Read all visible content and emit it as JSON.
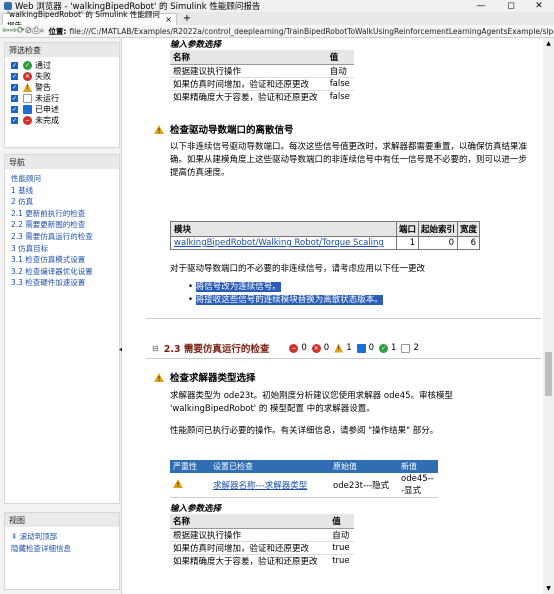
{
  "window": {
    "title": "Web 浏览器 - 'walkingBipedRobot' 的 Simulink 性能顾问报告",
    "min": "—",
    "max": "◻",
    "close": "✕"
  },
  "tab": {
    "label": "'walkingBipedRobot' 的 Simulink 性能顾问报告",
    "close": "×",
    "new": "+"
  },
  "address": {
    "label": "位置:",
    "url": "file:///C:/MATLAB/Examples/R2022a/control_deeplearning/TrainBipedRobotToWalkUsingReinforcementLearningAgentsExample/slprj/mo"
  },
  "filter": {
    "title": "筛选检查",
    "items": [
      {
        "label": "通过",
        "color": "#2e9e3e",
        "glyph": "✓"
      },
      {
        "label": "失败",
        "color": "#d0302a",
        "glyph": "✕"
      },
      {
        "label": "警告",
        "color": "#e3a21a",
        "glyph": "!"
      },
      {
        "label": "未运行",
        "color": "#ffffff",
        "glyph": ""
      },
      {
        "label": "已申述",
        "color": "#1c6fd1",
        "glyph": "■"
      },
      {
        "label": "未完成",
        "color": "#d0302a",
        "glyph": "−"
      }
    ]
  },
  "nav": {
    "title": "导航",
    "links": [
      "性能顾问",
      "1 基线",
      "2 仿真",
      "2.1 更新前执行的检查",
      "2.2 需要更新图的检查",
      "2.3 需要仿真运行的检查",
      "3 仿真目标",
      "3.1 检查仿真模式设置",
      "3.2 检查编译器优化设置",
      "3.3 检查硬件加速设置"
    ]
  },
  "view": {
    "title": "视图",
    "links": [
      "滚动到顶部",
      "隐藏检查详细信息"
    ]
  },
  "top_params": {
    "title": "输入参数选择",
    "header": [
      "名称",
      "值"
    ],
    "rows": [
      [
        "根据建议执行操作",
        "自动"
      ],
      [
        "如果仿真时间增加，验证和还原更改",
        "false"
      ],
      [
        "如果精确度大于容差，验证和还原更改",
        "false"
      ]
    ]
  },
  "sec1": {
    "title": "检查驱动导数端口的离散信号",
    "para": "以下非连续信号驱动导数端口。每次这些信号值更改时，求解器都需要重置，以确保仿真结果准确。如果从建模角度上这些驱动导数端口的非连续信号中有任一信号是不必要的，则可以进一步提高仿真速度。",
    "table_header": [
      "模块",
      "端口",
      "起始索引",
      "宽度"
    ],
    "table_rows": [
      [
        "walkingBipedRobot/Walking Robot/Torque Scaling",
        "1",
        "0",
        "6"
      ]
    ],
    "suggest": "对于驱动导数端口的不必要的非连续信号，请考虑应用以下任一更改",
    "bullets": [
      "将信号改为连续信号。",
      "将接收这些信号的连续模块替换为离散状态版本。"
    ]
  },
  "sec23": {
    "toggle": "⊟",
    "title": "2.3 需要仿真运行的检查",
    "counts": [
      {
        "glyph": "−",
        "color": "#d0302a",
        "n": "0"
      },
      {
        "glyph": "✕",
        "color": "#d0302a",
        "n": "0"
      },
      {
        "glyph": "!",
        "color": "#e3a21a",
        "n": "1"
      },
      {
        "glyph": "■",
        "color": "#1c6fd1",
        "n": "0"
      },
      {
        "glyph": "✓",
        "color": "#2e9e3e",
        "n": "1"
      },
      {
        "glyph": "",
        "color": "#ffffff",
        "n": "2"
      }
    ]
  },
  "sec2": {
    "title": "检查求解器类型选择",
    "para1": "求解器类型为 ode23t。初始刚度分析建议您使用求解器 ode45。审核模型 'walkingBipedRobot' 的 模型配置 中的求解器设置。",
    "para2": "性能顾问已执行必要的操作。有关详细信息，请参阅 \"操作结果\" 部分。",
    "table_header": [
      "严重性",
      "设置已检查",
      "原始值",
      "新值"
    ],
    "table_rows": [
      [
        "",
        "求解器名称---求解器类型",
        "ode23t---隐式",
        "ode45---显式"
      ]
    ]
  },
  "bottom_params": {
    "title": "输入参数选择",
    "header": [
      "名称",
      "值"
    ],
    "rows": [
      [
        "根据建议执行操作",
        "自动"
      ],
      [
        "如果仿真时间增加，验证和还原更改",
        "true"
      ],
      [
        "如果精确度大于容差，验证和还原更改",
        "true"
      ]
    ]
  }
}
